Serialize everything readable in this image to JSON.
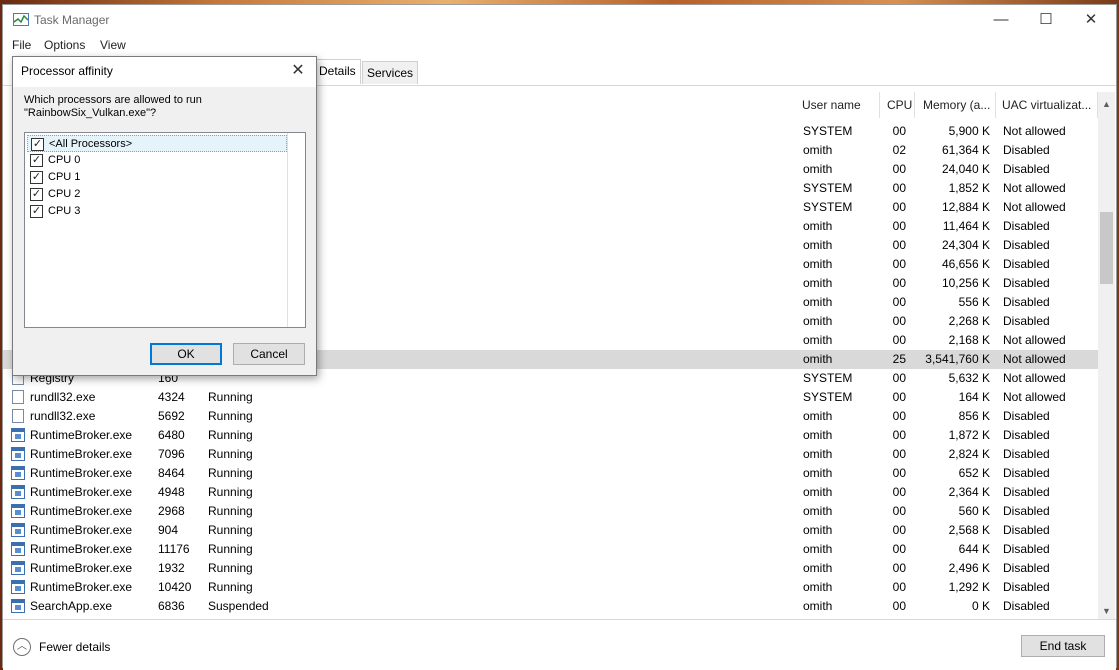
{
  "window": {
    "title": "Task Manager",
    "controls": {
      "minimize": "—",
      "maximize": "☐",
      "close": "✕"
    }
  },
  "menu": [
    "File",
    "Options",
    "View"
  ],
  "tabs": [
    {
      "label": "Details",
      "active": true
    },
    {
      "label": "Services",
      "active": false
    }
  ],
  "table": {
    "columns": [
      "User name",
      "CPU",
      "Memory (a...",
      "UAC virtualizat..."
    ],
    "rows": [
      {
        "name": "",
        "pid": "",
        "status": "",
        "user": "SYSTEM",
        "cpu": "00",
        "mem": "5,900 K",
        "uac": "Not allowed"
      },
      {
        "name": "",
        "pid": "",
        "status": "",
        "user": "omith",
        "cpu": "02",
        "mem": "61,364 K",
        "uac": "Disabled"
      },
      {
        "name": "",
        "pid": "",
        "status": "",
        "user": "omith",
        "cpu": "00",
        "mem": "24,040 K",
        "uac": "Disabled"
      },
      {
        "name": "",
        "pid": "",
        "status": "",
        "user": "SYSTEM",
        "cpu": "00",
        "mem": "1,852 K",
        "uac": "Not allowed"
      },
      {
        "name": "",
        "pid": "",
        "status": "",
        "user": "SYSTEM",
        "cpu": "00",
        "mem": "12,884 K",
        "uac": "Not allowed"
      },
      {
        "name": "",
        "pid": "",
        "status": "",
        "user": "omith",
        "cpu": "00",
        "mem": "11,464 K",
        "uac": "Disabled"
      },
      {
        "name": "",
        "pid": "",
        "status": "",
        "user": "omith",
        "cpu": "00",
        "mem": "24,304 K",
        "uac": "Disabled"
      },
      {
        "name": "",
        "pid": "",
        "status": "",
        "user": "omith",
        "cpu": "00",
        "mem": "46,656 K",
        "uac": "Disabled"
      },
      {
        "name": "",
        "pid": "",
        "status": "",
        "user": "omith",
        "cpu": "00",
        "mem": "10,256 K",
        "uac": "Disabled"
      },
      {
        "name": "",
        "pid": "",
        "status": "",
        "user": "omith",
        "cpu": "00",
        "mem": "556 K",
        "uac": "Disabled"
      },
      {
        "name": "",
        "pid": "",
        "status": "",
        "user": "omith",
        "cpu": "00",
        "mem": "2,268 K",
        "uac": "Disabled"
      },
      {
        "name": "",
        "pid": "",
        "status": "",
        "user": "omith",
        "cpu": "00",
        "mem": "2,168 K",
        "uac": "Not allowed"
      },
      {
        "name": "",
        "pid": "",
        "status": "",
        "user": "omith",
        "cpu": "25",
        "mem": "3,541,760 K",
        "uac": "Not allowed",
        "selected": true
      },
      {
        "name": "Registry",
        "pid": "160",
        "status": "",
        "user": "SYSTEM",
        "cpu": "00",
        "mem": "5,632 K",
        "uac": "Not allowed",
        "icon": "doc"
      },
      {
        "name": "rundll32.exe",
        "pid": "4324",
        "status": "Running",
        "user": "SYSTEM",
        "cpu": "00",
        "mem": "164 K",
        "uac": "Not allowed",
        "icon": "doc"
      },
      {
        "name": "rundll32.exe",
        "pid": "5692",
        "status": "Running",
        "user": "omith",
        "cpu": "00",
        "mem": "856 K",
        "uac": "Disabled",
        "icon": "doc"
      },
      {
        "name": "RuntimeBroker.exe",
        "pid": "6480",
        "status": "Running",
        "user": "omith",
        "cpu": "00",
        "mem": "1,872 K",
        "uac": "Disabled",
        "icon": "exe"
      },
      {
        "name": "RuntimeBroker.exe",
        "pid": "7096",
        "status": "Running",
        "user": "omith",
        "cpu": "00",
        "mem": "2,824 K",
        "uac": "Disabled",
        "icon": "exe"
      },
      {
        "name": "RuntimeBroker.exe",
        "pid": "8464",
        "status": "Running",
        "user": "omith",
        "cpu": "00",
        "mem": "652 K",
        "uac": "Disabled",
        "icon": "exe"
      },
      {
        "name": "RuntimeBroker.exe",
        "pid": "4948",
        "status": "Running",
        "user": "omith",
        "cpu": "00",
        "mem": "2,364 K",
        "uac": "Disabled",
        "icon": "exe"
      },
      {
        "name": "RuntimeBroker.exe",
        "pid": "2968",
        "status": "Running",
        "user": "omith",
        "cpu": "00",
        "mem": "560 K",
        "uac": "Disabled",
        "icon": "exe"
      },
      {
        "name": "RuntimeBroker.exe",
        "pid": "904",
        "status": "Running",
        "user": "omith",
        "cpu": "00",
        "mem": "2,568 K",
        "uac": "Disabled",
        "icon": "exe"
      },
      {
        "name": "RuntimeBroker.exe",
        "pid": "11176",
        "status": "Running",
        "user": "omith",
        "cpu": "00",
        "mem": "644 K",
        "uac": "Disabled",
        "icon": "exe"
      },
      {
        "name": "RuntimeBroker.exe",
        "pid": "1932",
        "status": "Running",
        "user": "omith",
        "cpu": "00",
        "mem": "2,496 K",
        "uac": "Disabled",
        "icon": "exe"
      },
      {
        "name": "RuntimeBroker.exe",
        "pid": "10420",
        "status": "Running",
        "user": "omith",
        "cpu": "00",
        "mem": "1,292 K",
        "uac": "Disabled",
        "icon": "exe"
      },
      {
        "name": "SearchApp.exe",
        "pid": "6836",
        "status": "Suspended",
        "user": "omith",
        "cpu": "00",
        "mem": "0 K",
        "uac": "Disabled",
        "icon": "exe"
      }
    ]
  },
  "footer": {
    "fewer_details": "Fewer details",
    "end_task": "End task"
  },
  "dialog": {
    "title": "Processor affinity",
    "question": "Which processors are allowed to run \"RainbowSix_Vulkan.exe\"?",
    "items": [
      {
        "label": "<All Processors>",
        "checked": true
      },
      {
        "label": "CPU 0",
        "checked": true
      },
      {
        "label": "CPU 1",
        "checked": true
      },
      {
        "label": "CPU 2",
        "checked": true
      },
      {
        "label": "CPU 3",
        "checked": true
      }
    ],
    "ok": "OK",
    "cancel": "Cancel",
    "close": "✕"
  },
  "colors": {
    "selection": "#d9d9d9",
    "accent": "#0078d7"
  }
}
